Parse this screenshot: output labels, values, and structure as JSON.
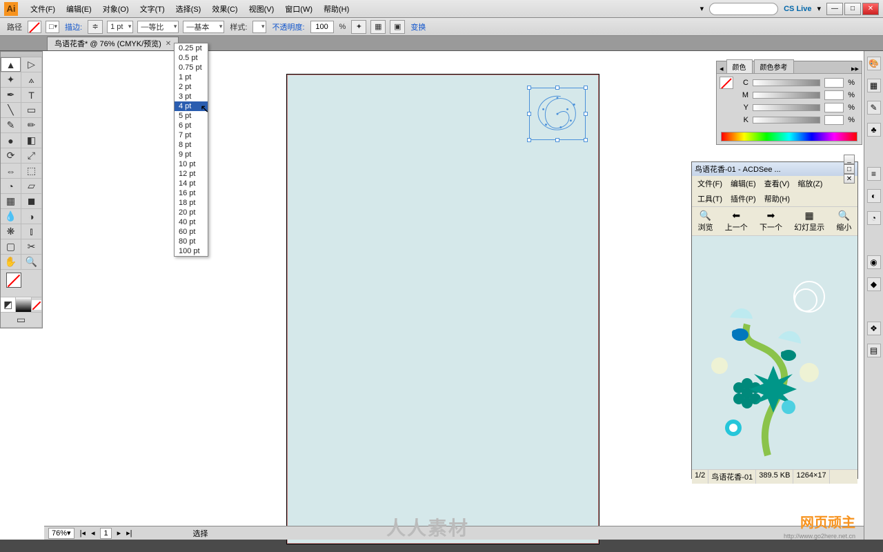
{
  "menu": {
    "items": [
      "文件(F)",
      "编辑(E)",
      "对象(O)",
      "文字(T)",
      "选择(S)",
      "效果(C)",
      "视图(V)",
      "窗口(W)",
      "帮助(H)"
    ],
    "cslive": "CS Live"
  },
  "options": {
    "path_label": "路径",
    "stroke_label": "描边:",
    "stroke_value": "1 pt",
    "profile_label": "等比",
    "brush_label": "基本",
    "style_label": "样式:",
    "opacity_label": "不透明度:",
    "opacity_value": "100",
    "opacity_pct": "%",
    "transform_label": "变换"
  },
  "doc_tab": "鸟语花香* @ 76% (CMYK/预览)",
  "stroke_sizes": [
    "0.25 pt",
    "0.5 pt",
    "0.75 pt",
    "1 pt",
    "2 pt",
    "3 pt",
    "4 pt",
    "5 pt",
    "6 pt",
    "7 pt",
    "8 pt",
    "9 pt",
    "10 pt",
    "12 pt",
    "14 pt",
    "16 pt",
    "18 pt",
    "20 pt",
    "40 pt",
    "60 pt",
    "80 pt",
    "100 pt"
  ],
  "stroke_sel_index": 6,
  "color_panel": {
    "tab1": "颜色",
    "tab2": "颜色参考",
    "channels": [
      "C",
      "M",
      "Y",
      "K"
    ],
    "pct": "%"
  },
  "acdsee": {
    "title": "鸟语花香-01 - ACDSee ...",
    "menu": [
      "文件(F)",
      "编辑(E)",
      "查看(V)",
      "缩放(Z)",
      "工具(T)",
      "插件(P)",
      "帮助(H)"
    ],
    "tools": [
      {
        "ico": "🔍",
        "label": "浏览"
      },
      {
        "ico": "⬅",
        "label": "上一个"
      },
      {
        "ico": "➡",
        "label": "下一个"
      },
      {
        "ico": "▦",
        "label": "幻灯显示"
      },
      {
        "ico": "🔍",
        "label": "缩小"
      }
    ],
    "status": [
      "1/2",
      "鸟语花香-01",
      "389.5 KB",
      "1264×17"
    ]
  },
  "status": {
    "zoom": "76%",
    "page": "1",
    "select": "选择"
  },
  "watermark": "人人素材",
  "wm2": "网页顽主",
  "wm2b": "http://www.go2here.net.cn"
}
